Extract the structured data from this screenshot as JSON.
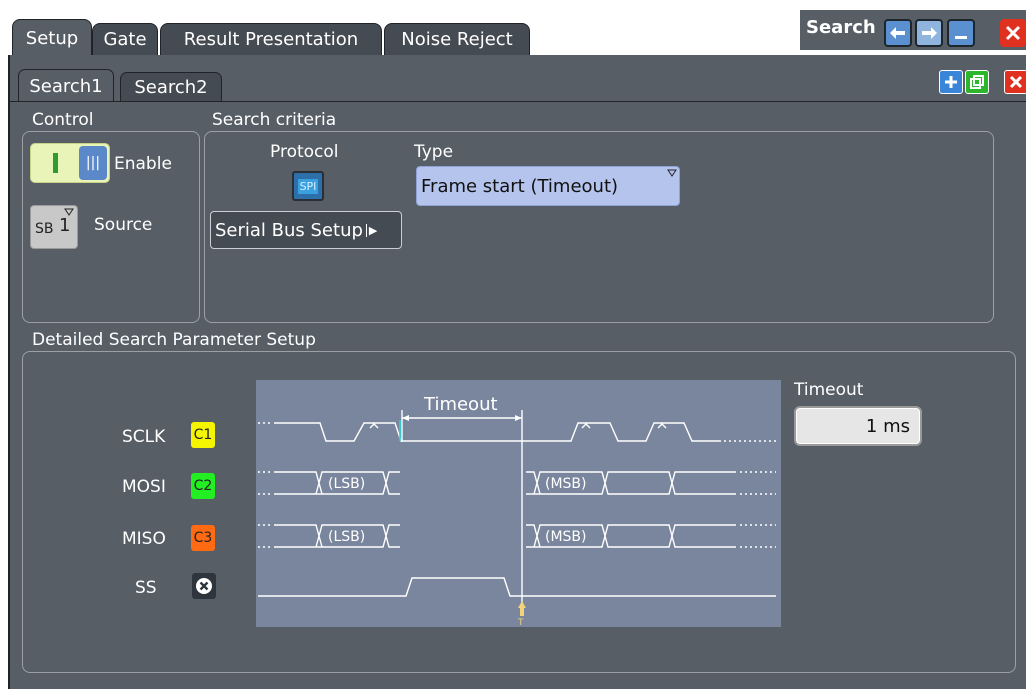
{
  "window": {
    "title": "Search",
    "main_tabs": [
      "Setup",
      "Gate",
      "Result Presentation",
      "Noise Reject"
    ],
    "sub_tabs": [
      "Search1",
      "Search2"
    ]
  },
  "control": {
    "title": "Control",
    "enable_label": "Enable",
    "enable_state": "I",
    "source_label": "Source",
    "source_value": "SB",
    "source_index": "1"
  },
  "criteria": {
    "title": "Search criteria",
    "protocol_label": "Protocol",
    "protocol_icon_text": "SPI",
    "type_label": "Type",
    "type_value": "Frame start (Timeout)",
    "serial_bus_button": "Serial Bus Setup"
  },
  "detail": {
    "title": "Detailed Search Parameter Setup",
    "timeout_label": "Timeout",
    "timeout_value": "1 ms",
    "diagram": {
      "timeout_annotation": "Timeout",
      "lsb_label": "(LSB)",
      "msb_label": "(MSB)",
      "trigger_marker": "T",
      "signals": [
        {
          "name": "SCLK",
          "channel": "C1",
          "color": "#f5f500"
        },
        {
          "name": "MOSI",
          "channel": "C2",
          "color": "#22ee22"
        },
        {
          "name": "MISO",
          "channel": "C3",
          "color": "#ff6a12"
        },
        {
          "name": "SS",
          "channel": "",
          "color": "#2e353c"
        }
      ]
    }
  },
  "colors": {
    "panel_bg": "#575e66",
    "tab_inactive": "#454b52",
    "accent_blue": "#4a90d9",
    "diagram_bg": "#7a869d"
  },
  "icons": [
    "undo-icon",
    "redo-icon",
    "minimize-icon",
    "close-icon",
    "add-icon",
    "copy-icon",
    "delete-icon",
    "spi-icon",
    "dropdown-triangle-icon",
    "arrow-right-icon",
    "x-circle-icon"
  ]
}
